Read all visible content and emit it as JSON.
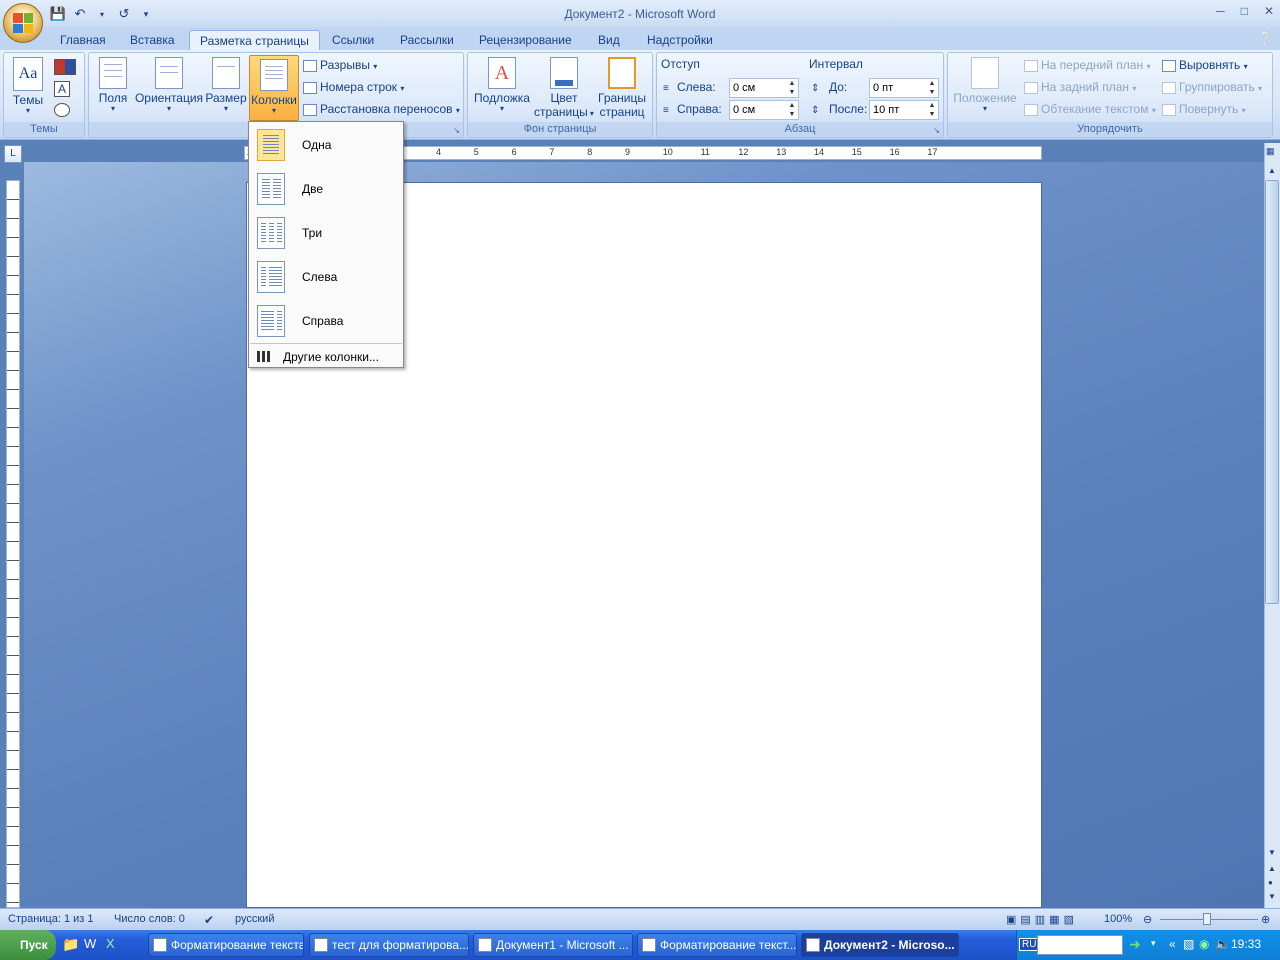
{
  "window": {
    "title": "Документ2 - Microsoft Word"
  },
  "tabs": [
    {
      "label": "Главная"
    },
    {
      "label": "Вставка"
    },
    {
      "label": "Разметка страницы"
    },
    {
      "label": "Ссылки"
    },
    {
      "label": "Рассылки"
    },
    {
      "label": "Рецензирование"
    },
    {
      "label": "Вид"
    },
    {
      "label": "Надстройки"
    }
  ],
  "ribbon": {
    "themes": {
      "label": "Темы",
      "button": "Темы"
    },
    "page_setup": {
      "label": "Парамет",
      "fields": "Поля",
      "orientation": "Ориентация",
      "size": "Размер",
      "columns": "Колонки",
      "breaks": "Разрывы",
      "line_numbers": "Номера строк",
      "hyphenation": "Расстановка переносов"
    },
    "page_background": {
      "label": "Фон страницы",
      "watermark": "Подложка",
      "page_color_1": "Цвет",
      "page_color_2": "страницы",
      "borders_1": "Границы",
      "borders_2": "страниц"
    },
    "paragraph": {
      "label": "Абзац",
      "indent_title": "Отступ",
      "left_label": "Слева:",
      "left_value": "0 см",
      "right_label": "Справа:",
      "right_value": "0 см",
      "spacing_title": "Интервал",
      "before_label": "До:",
      "before_value": "0 пт",
      "after_label": "После:",
      "after_value": "10 пт"
    },
    "arrange": {
      "label": "Упорядочить",
      "position": "Положение",
      "bring_front": "На передний план",
      "send_back": "На задний план",
      "wrap": "Обтекание текстом",
      "align": "Выровнять",
      "group": "Группировать",
      "rotate": "Повернуть"
    }
  },
  "columns_menu": {
    "items": [
      {
        "label": "Одна"
      },
      {
        "label": "Две"
      },
      {
        "label": "Три"
      },
      {
        "label": "Слева"
      },
      {
        "label": "Справа"
      }
    ],
    "more": "Другие колонки..."
  },
  "ruler": {
    "numbers": [
      "2",
      "1",
      "1",
      "2",
      "3",
      "4",
      "5",
      "6",
      "7",
      "8",
      "9",
      "10",
      "11",
      "12",
      "13",
      "14",
      "15",
      "16",
      "17"
    ]
  },
  "status": {
    "page": "Страница: 1 из 1",
    "words": "Число слов: 0",
    "language": "русский",
    "zoom": "100%"
  },
  "taskbar": {
    "start": "Пуск",
    "buttons": [
      {
        "label": "Форматирование текста"
      },
      {
        "label": "тест для форматирова..."
      },
      {
        "label": "Документ1 - Microsoft ..."
      },
      {
        "label": "Форматирование текст..."
      },
      {
        "label": "Документ2 - Microso..."
      }
    ],
    "lang": "RU",
    "clock": "19:33"
  }
}
